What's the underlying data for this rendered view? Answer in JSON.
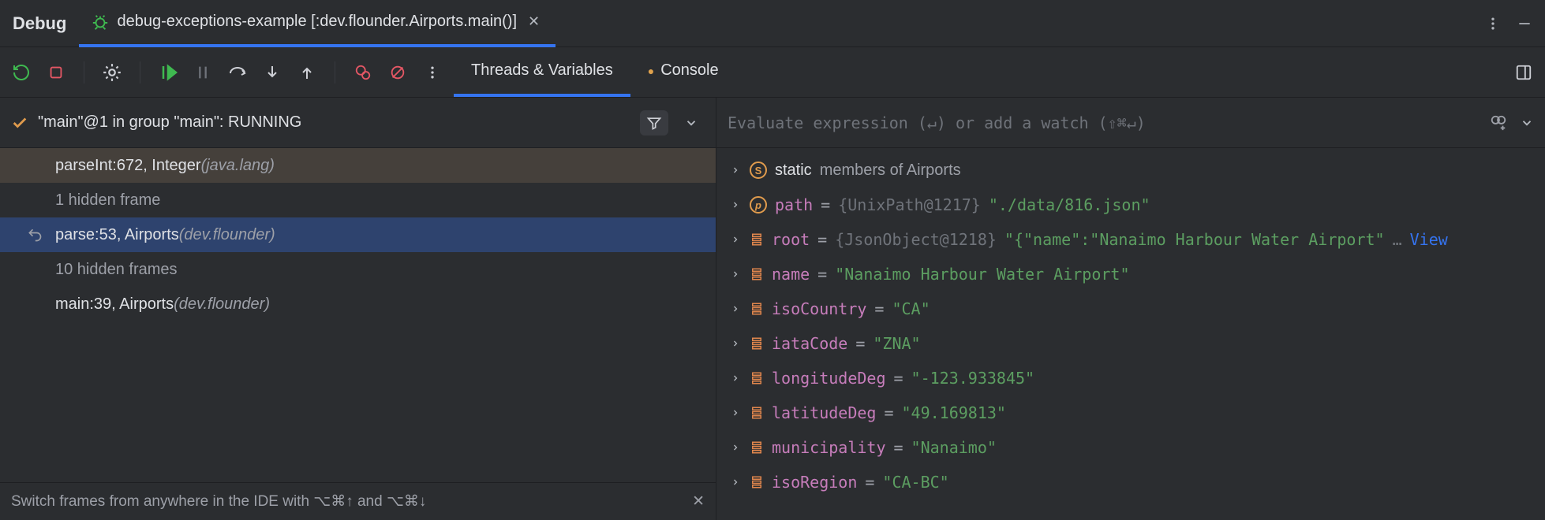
{
  "header": {
    "title": "Debug",
    "run_tab_label": "debug-exceptions-example [:dev.flounder.Airports.main()]"
  },
  "tabs": {
    "threads": "Threads & Variables",
    "console": "Console"
  },
  "thread_status": "\"main\"@1 in group \"main\": RUNNING",
  "frames": [
    {
      "kind": "frame",
      "loc": "parseInt:672, Integer ",
      "pkg": "(java.lang)",
      "style": "brown"
    },
    {
      "kind": "meta",
      "text": "1 hidden frame"
    },
    {
      "kind": "frame",
      "loc": "parse:53, Airports ",
      "pkg": "(dev.flounder)",
      "style": "selected",
      "ret": true
    },
    {
      "kind": "meta",
      "text": "10 hidden frames"
    },
    {
      "kind": "frame",
      "loc": "main:39, Airports ",
      "pkg": "(dev.flounder)"
    }
  ],
  "hint": "Switch frames from anywhere in the IDE with ⌥⌘↑ and ⌥⌘↓",
  "eval_placeholder": "Evaluate expression (↵) or add a watch (⇧⌘↵)",
  "vars": [
    {
      "icon": "s",
      "name_html": "static",
      "secondary": "members of Airports"
    },
    {
      "icon": "p",
      "name": "path",
      "ref": "{UnixPath@1217}",
      "value": "\"./data/816.json\""
    },
    {
      "icon": "f",
      "name": "root",
      "ref": "{JsonObject@1218}",
      "value_trunc": "\"{\"name\":\"Nanaimo Harbour Water Airport\"",
      "view": true
    },
    {
      "icon": "f",
      "name": "name",
      "value": "\"Nanaimo Harbour Water Airport\""
    },
    {
      "icon": "f",
      "name": "isoCountry",
      "value": "\"CA\""
    },
    {
      "icon": "f",
      "name": "iataCode",
      "value": "\"ZNA\""
    },
    {
      "icon": "f",
      "name": "longitudeDeg",
      "value": "\"-123.933845\""
    },
    {
      "icon": "f",
      "name": "latitudeDeg",
      "value": "\"49.169813\""
    },
    {
      "icon": "f",
      "name": "municipality",
      "value": "\"Nanaimo\""
    },
    {
      "icon": "f",
      "name": "isoRegion",
      "value": "\"CA-BC\""
    }
  ],
  "view_label": "View",
  "ellipsis": "…"
}
